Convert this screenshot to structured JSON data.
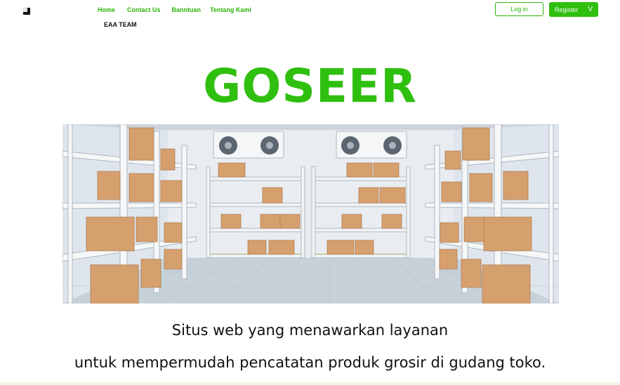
{
  "nav": {
    "home": "Home",
    "contact": "Contact Us",
    "help": "Banntuan",
    "about": "Tentang Kami",
    "team": "EAA TEAM"
  },
  "auth": {
    "login": "Log in",
    "register": "Register",
    "register_icon": "V"
  },
  "hero": {
    "title": "GOSEER",
    "image": "warehouse-storage-room-illustration",
    "tagline_1": "Situs web yang menawarkan layanan",
    "tagline_2": "untuk mempermudah pencatatan produk grosir di gudang toko."
  },
  "colors": {
    "brand": "#2fbf0f",
    "text": "#111111"
  }
}
